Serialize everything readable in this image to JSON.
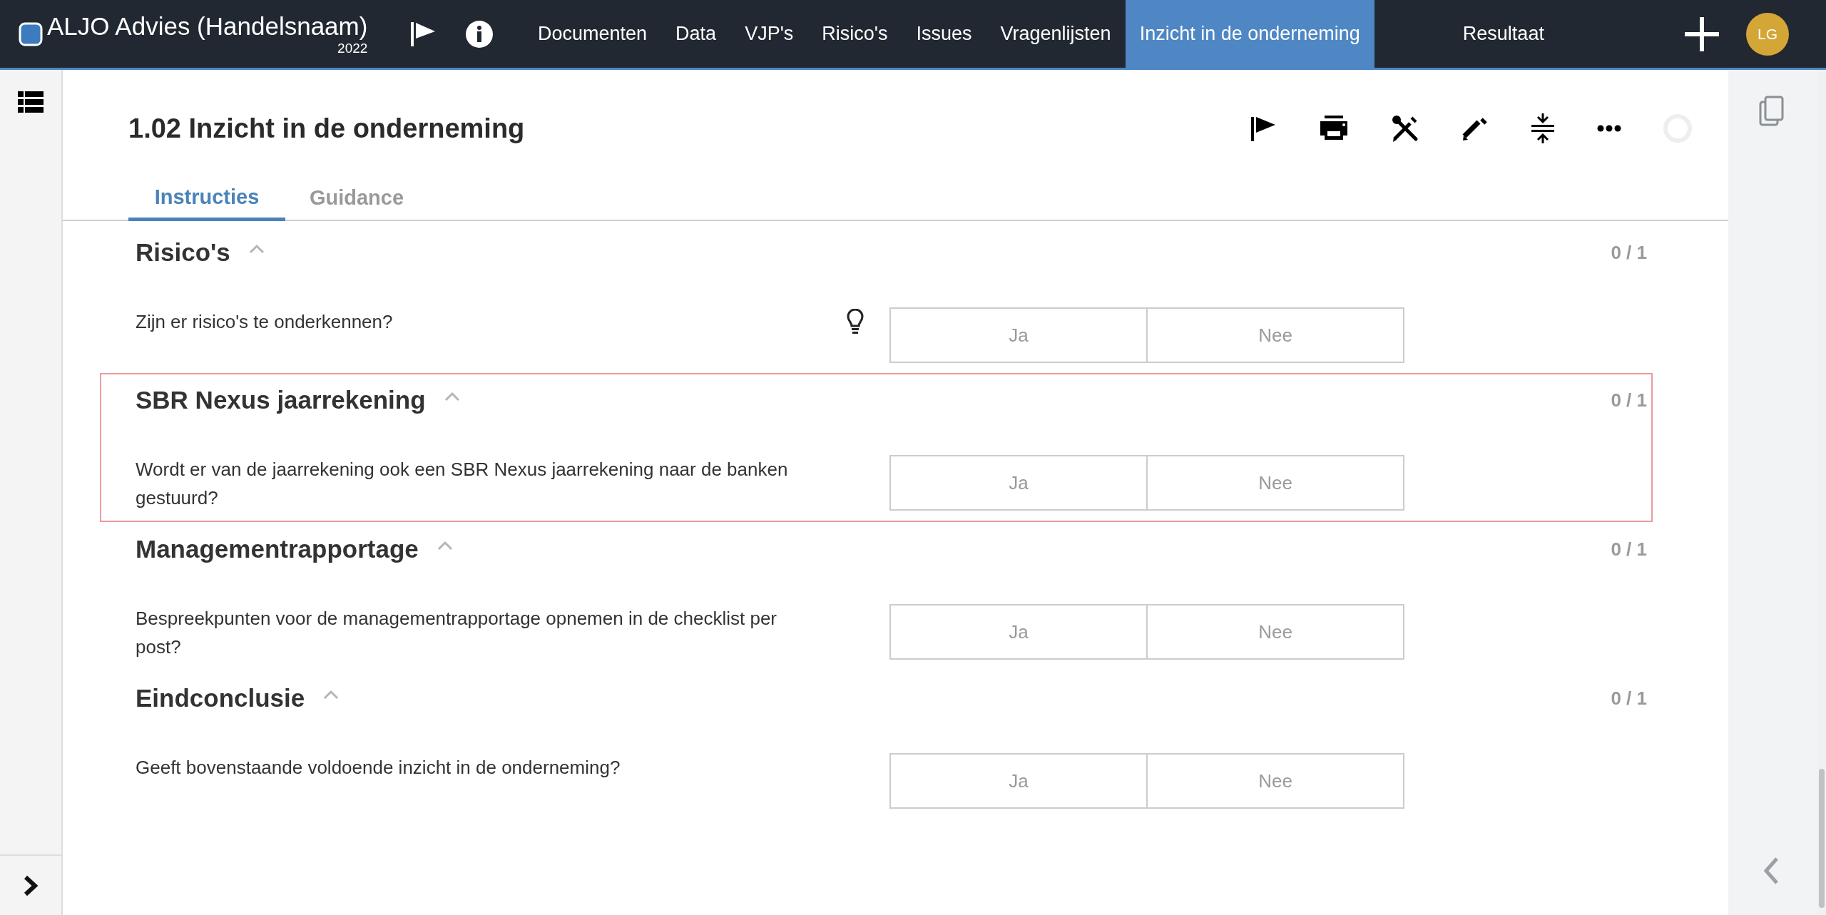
{
  "app": {
    "title": "ALJO Advies (Handelsnaam)",
    "year": "2022"
  },
  "nav": [
    {
      "label": "Documenten",
      "selected": false
    },
    {
      "label": "Data",
      "selected": false
    },
    {
      "label": "VJP's",
      "selected": false
    },
    {
      "label": "Risico's",
      "selected": false
    },
    {
      "label": "Issues",
      "selected": false
    },
    {
      "label": "Vragenlijsten",
      "selected": false
    },
    {
      "label": "Inzicht in de onderneming",
      "selected": true
    },
    {
      "label": "Resultaat",
      "selected": false
    }
  ],
  "user": {
    "initials": "LG"
  },
  "page": {
    "title": "1.02 Inzicht in de onderneming"
  },
  "tabs": [
    {
      "label": "Instructies",
      "selected": true
    },
    {
      "label": "Guidance",
      "selected": false
    }
  ],
  "sections": [
    {
      "title": "Risico's",
      "expanded": true,
      "count": "0 / 1",
      "highlighted": false,
      "questions": [
        {
          "text": "Zijn er risico's te onderkennen?",
          "hint": true,
          "options": [
            {
              "label": "Ja",
              "selected": false
            },
            {
              "label": "Nee",
              "selected": false
            }
          ]
        }
      ]
    },
    {
      "title": "SBR Nexus jaarrekening",
      "expanded": true,
      "count": "0 / 1",
      "highlighted": true,
      "questions": [
        {
          "text": "Wordt er van de jaarrekening ook een SBR Nexus jaarrekening naar de banken gestuurd?",
          "hint": false,
          "options": [
            {
              "label": "Ja",
              "selected": false
            },
            {
              "label": "Nee",
              "selected": false
            }
          ]
        }
      ]
    },
    {
      "title": "Managementrapportage",
      "expanded": true,
      "count": "0 / 1",
      "highlighted": false,
      "questions": [
        {
          "text": "Bespreekpunten voor de managementrapportage opnemen in de checklist per post?",
          "hint": false,
          "options": [
            {
              "label": "Ja",
              "selected": false
            },
            {
              "label": "Nee",
              "selected": false
            }
          ]
        }
      ]
    },
    {
      "title": "Eindconclusie",
      "expanded": true,
      "count": "0 / 1",
      "highlighted": false,
      "questions": [
        {
          "text": "Geeft bovenstaande voldoende inzicht in de onderneming?",
          "hint": false,
          "options": [
            {
              "label": "Ja",
              "selected": false
            },
            {
              "label": "Nee",
              "selected": false
            }
          ]
        }
      ]
    }
  ]
}
